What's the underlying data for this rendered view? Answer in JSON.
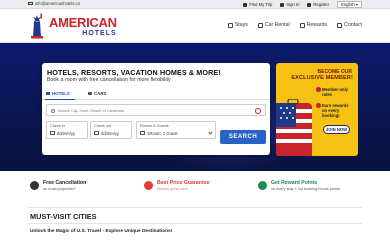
{
  "topbar": {
    "email": "info@americanhotels.co",
    "links": [
      "Find My Trip",
      "Sign In",
      "Register"
    ],
    "language": "English"
  },
  "header": {
    "logo_main": "AMERICAN",
    "logo_sub": "HOTELS",
    "nav": [
      "Stays",
      "Car Rental",
      "Rewards",
      "Contact"
    ]
  },
  "search_card": {
    "title": "HOTELS, RESORTS, VACATION HOMES & MORE!",
    "subtitle": "Book a room with free cancellation for more flexibility",
    "tabs": [
      "HOTELS",
      "CARS"
    ],
    "search_placeholder": "Search City, Hotel, Resort or Landmark",
    "checkin_label": "Check in",
    "checkin_value": "dd/mm/yy",
    "checkout_label": "Check out",
    "checkout_value": "dd/mm/yy",
    "rooms_label": "Rooms & Guests",
    "rooms_value": "1Room, 1 Guest",
    "search_button": "SEARCH"
  },
  "promo": {
    "line1": "BECOME OUR",
    "line2": "EXCLUSIVE MEMBER!",
    "benefit1": "Member-only rates",
    "benefit2": "Earn rewards on every booking!",
    "join_button": "JOIN NOW"
  },
  "features": [
    {
      "title": "Free Cancellation",
      "subtitle": "on most properties*"
    },
    {
      "title": "Best Price Guarantee",
      "subtitle": "Always great rates"
    },
    {
      "title": "Get Reward Points",
      "subtitle": "on every stay + 1st booking bonus points"
    }
  ],
  "section": {
    "title": "MUST-VISIT CITIES",
    "subtitle": "Unlock the Magic of U.S. Travel - Explore Unique Destinations!"
  },
  "colors": {
    "brand_red": "#c7252b",
    "brand_blue": "#1f3a8a",
    "hero_bg": "#0c1a6e",
    "search_button": "#2a63c8",
    "promo_bg": "#f6c315"
  }
}
